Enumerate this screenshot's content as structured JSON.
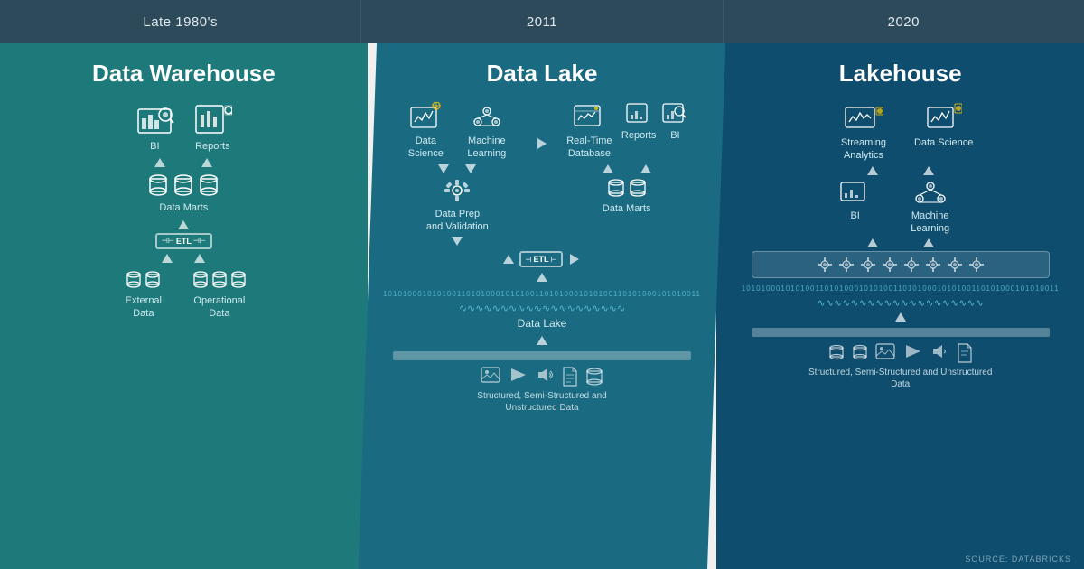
{
  "eras": [
    {
      "label": "Late 1980's"
    },
    {
      "label": "2011"
    },
    {
      "label": "2020"
    }
  ],
  "panels": {
    "dw": {
      "title": "Data Warehouse",
      "items": {
        "bi_label": "BI",
        "reports_label": "Reports",
        "data_marts_label": "Data Marts",
        "etl_label": "ETL",
        "external_data_label": "External Data",
        "operational_data_label": "Operational Data"
      }
    },
    "dl": {
      "title": "Data Lake",
      "items": {
        "data_science_label": "Data Science",
        "machine_learning_label": "Machine Learning",
        "data_prep_label": "Data Prep\nand Validation",
        "real_time_db_label": "Real-Time\nDatabase",
        "reports_label": "Reports",
        "bi_label": "BI",
        "data_marts_label": "Data Marts",
        "etl_label": "ETL",
        "data_lake_label": "Data Lake",
        "structured_label": "Structured, Semi-Structured and Unstructured Data"
      }
    },
    "lh": {
      "title": "Lakehouse",
      "items": {
        "streaming_analytics_label": "Streaming Analytics",
        "data_science_label": "Data Science",
        "bi_label": "BI",
        "machine_learning_label": "Machine Learning",
        "structured_label": "Structured, Semi-Structured and Unstructured Data"
      }
    }
  },
  "source": "SOURCE: DATABRICKS",
  "binary": "10101000101010011010100010101001101010001010100110101000101010011",
  "wave": "∿∿∿∿∿∿∿∿∿∿∿∿∿∿∿∿∿∿∿∿"
}
